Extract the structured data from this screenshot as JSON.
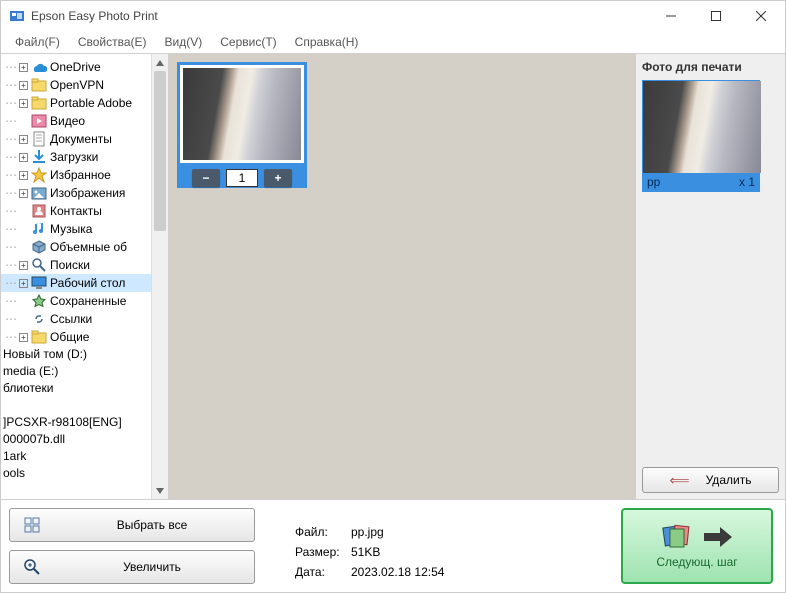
{
  "window": {
    "title": "Epson Easy Photo Print"
  },
  "menu": {
    "file": "Файл(F)",
    "properties": "Свойства(E)",
    "view": "Вид(V)",
    "service": "Сервис(T)",
    "help": "Справка(H)"
  },
  "tree": [
    {
      "icon": "onedrive",
      "label": "OneDrive",
      "exp": true
    },
    {
      "icon": "folder",
      "label": "OpenVPN",
      "exp": true
    },
    {
      "icon": "folder",
      "label": "Portable Adobe",
      "exp": true
    },
    {
      "icon": "video",
      "label": "Видео",
      "exp": false
    },
    {
      "icon": "docs",
      "label": "Документы",
      "exp": true
    },
    {
      "icon": "download",
      "label": "Загрузки",
      "exp": true
    },
    {
      "icon": "star",
      "label": "Избранное",
      "exp": true
    },
    {
      "icon": "images",
      "label": "Изображения",
      "exp": true
    },
    {
      "icon": "contacts",
      "label": "Контакты",
      "exp": false
    },
    {
      "icon": "music",
      "label": "Музыка",
      "exp": false
    },
    {
      "icon": "cube",
      "label": "Объемные об",
      "exp": false
    },
    {
      "icon": "search",
      "label": "Поиски",
      "exp": true
    },
    {
      "icon": "desktop",
      "label": "Рабочий стол",
      "exp": true,
      "sel": true
    },
    {
      "icon": "saved",
      "label": "Сохраненные",
      "exp": false
    },
    {
      "icon": "links",
      "label": "Ссылки",
      "exp": false
    },
    {
      "icon": "folder",
      "label": "Общие",
      "exp": true
    }
  ],
  "tree_flat": [
    "Новый том (D:)",
    "media (E:)",
    "блиотеки",
    "",
    "]PCSXR-r98108[ENG]",
    "000007b.dll",
    "1ark",
    "ools"
  ],
  "thumb": {
    "copies": "1"
  },
  "print": {
    "header": "Фото для печати",
    "name": "pp",
    "count": "x 1",
    "delete": "Удалить"
  },
  "bottom": {
    "select_all": "Выбрать все",
    "zoom": "Увеличить",
    "file_k": "Файл:",
    "file_v": "pp.jpg",
    "size_k": "Размер:",
    "size_v": "51KB",
    "date_k": "Дата:",
    "date_v": "2023.02.18 12:54",
    "next": "Следующ. шаг"
  }
}
